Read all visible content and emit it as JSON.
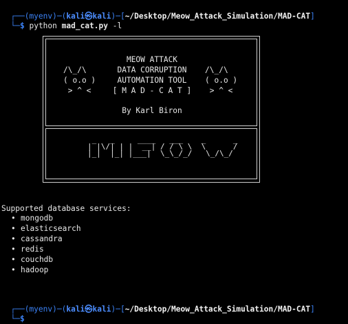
{
  "prompt1": {
    "corner_top": "┌──",
    "env": "(myenv)",
    "dash1": "─(",
    "user": "kali",
    "at": "㉿",
    "host": "kali",
    "close": ")",
    "dash2": "─[",
    "path": "~/Desktop/Meow_Attack_Simulation/MAD-CAT",
    "bracket_end": "]",
    "corner_bottom": "└─",
    "dollar": "$",
    "command_program": "python",
    "command_script": "mad_cat.py",
    "command_flag": "-l"
  },
  "banner": {
    "title_line1": "MEOW ATTACK",
    "title_line2": "DATA CORRUPTION",
    "title_line3": "AUTOMATION TOOL",
    "title_line4": "[ M A D - C A T ]",
    "author": "By Karl Biron",
    "cat_left": "/\\_/\\\n( o.o )\n > ^ <",
    "cat_right": "/\\_/\\\n( o.o )\n > ^ <",
    "meow_ascii": " _   _     ____   ___    _      _\n| |\\/| | |  __| / / \\ \\  \\      /\n|_|  |_| |___|  \\_\\_/_/   \\_/\\_/"
  },
  "output": {
    "heading": "Supported database services:",
    "bullet": "•",
    "services": [
      "mongodb",
      "elasticsearch",
      "cassandra",
      "redis",
      "couchdb",
      "hadoop"
    ]
  },
  "prompt2": {
    "corner_top": "┌──",
    "env": "(myenv)",
    "dash1": "─(",
    "user": "kali",
    "at": "㉿",
    "host": "kali",
    "close": ")",
    "dash2": "─[",
    "path": "~/Desktop/Meow_Attack_Simulation/MAD-CAT",
    "bracket_end": "]",
    "corner_bottom": "└─",
    "dollar": "$"
  },
  "colors": {
    "background": "#000000",
    "prompt_blue": "#3b82f6",
    "text": "#e8e8e8"
  }
}
